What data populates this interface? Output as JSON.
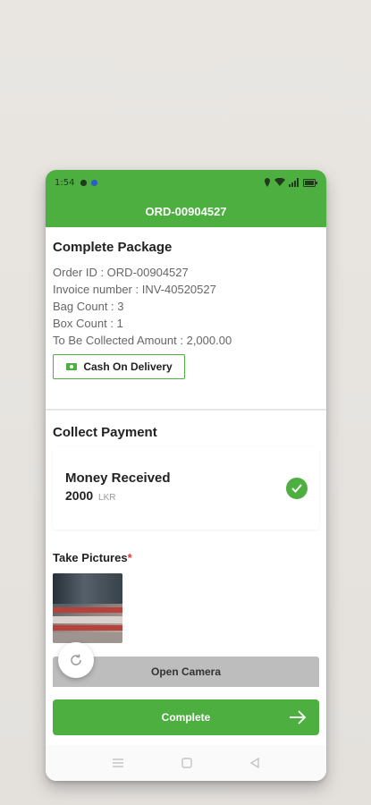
{
  "status_bar": {
    "time": "1:54"
  },
  "app_bar": {
    "title": "ORD-00904527"
  },
  "package": {
    "heading": "Complete Package",
    "order_id": "Order ID : ORD-00904527",
    "invoice": "Invoice number : INV-40520527",
    "bag_count": "Bag Count : 3",
    "box_count": "Box Count : 1",
    "collect_amount": "To Be Collected Amount : 2,000.00",
    "payment_method_label": "Cash On Delivery"
  },
  "payment": {
    "heading": "Collect Payment",
    "status_label": "Money Received",
    "amount": "2000",
    "currency": "LKR"
  },
  "pictures": {
    "label": "Take Pictures",
    "required_mark": "*",
    "open_camera_label": "Open Camera"
  },
  "footer": {
    "complete_label": "Complete"
  },
  "colors": {
    "primary": "#4caf3f",
    "required": "#e53935"
  },
  "icons": [
    "money-icon",
    "check-icon",
    "refresh-icon",
    "arrow-right-icon",
    "menu-icon",
    "home-icon",
    "back-icon"
  ]
}
